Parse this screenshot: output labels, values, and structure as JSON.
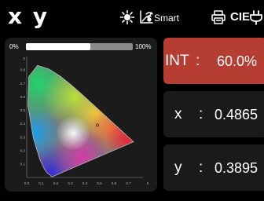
{
  "header": {
    "title": "x y",
    "icons": [
      "sun-settings-icon",
      "chart-line-icon",
      "smart-sensor-icon",
      "printer-icon",
      "plug-icon"
    ],
    "smart_label": "Smart",
    "cie_label": "CIE"
  },
  "progress": {
    "min_label": "0%",
    "max_label": "100%",
    "value": 0.6
  },
  "measurements": {
    "int": {
      "label": "INT",
      "colon": ":",
      "value": "60.0%"
    },
    "x": {
      "label": "x",
      "colon": ":",
      "value": "0.4865"
    },
    "y": {
      "label": "y",
      "colon": ":",
      "value": "0.3895"
    }
  },
  "chart_data": {
    "type": "scatter",
    "x_ticks": [
      "0.0",
      "0.1",
      "0.2",
      "0.3",
      "0.4",
      "0.5",
      "0.6",
      "0.7"
    ],
    "y_ticks": [
      "0.1",
      "0.2",
      "0.3",
      "0.4",
      "0.5",
      "0.6",
      "0.7",
      "0.8"
    ],
    "xlabel": "x",
    "ylabel": "y",
    "xlim": [
      0,
      0.8
    ],
    "ylim": [
      0,
      0.9
    ],
    "points": [
      {
        "x": 0.4865,
        "y": 0.3895
      }
    ]
  },
  "colors": {
    "int_panel": "#b53d32",
    "panel": "#1a1a1a",
    "progress_fill": "#ffffff",
    "progress_track": "#8a8a8a"
  }
}
